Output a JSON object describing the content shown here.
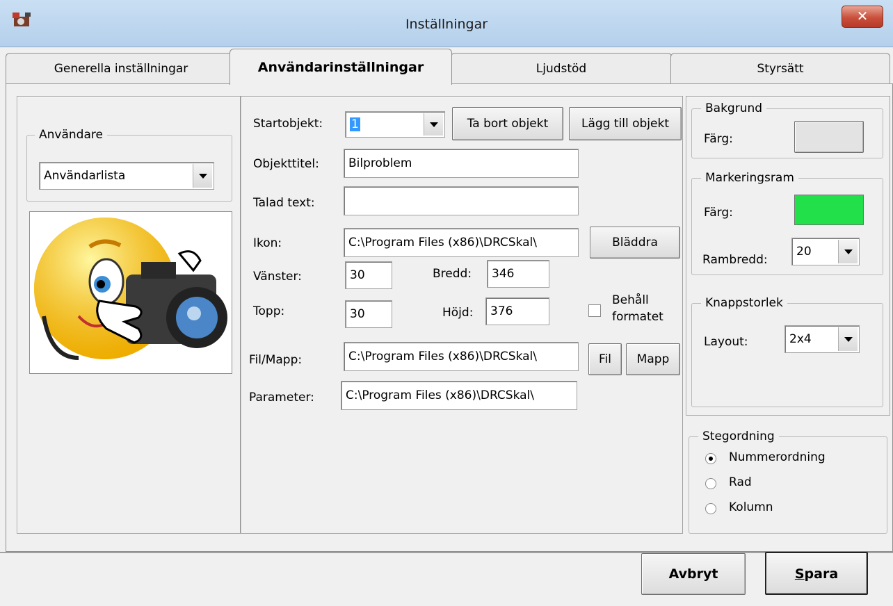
{
  "window": {
    "title": "Inställningar",
    "close_label": "✕"
  },
  "tabs": [
    "Generella inställningar",
    "Användarinställningar",
    "Ljudstöd",
    "Styrsätt"
  ],
  "users": {
    "group_label": "Användare",
    "dropdown_value": "Användarlista"
  },
  "form": {
    "startobjekt_label": "Startobjekt:",
    "startobjekt_value": "1",
    "remove_button": "Ta bort objekt",
    "add_button": "Lägg till objekt",
    "objekttitel_label": "Objekttitel:",
    "objekttitel_value": "Bilproblem",
    "talad_text_label": "Talad text:",
    "talad_text_value": "",
    "ikon_label": "Ikon:",
    "ikon_value": "C:\\Program Files (x86)\\DRCSkal\\",
    "browse_button": "Bläddra",
    "vanster_label": "Vänster:",
    "vanster_value": "30",
    "bredd_label": "Bredd:",
    "bredd_value": "346",
    "topp_label": "Topp:",
    "topp_value": "30",
    "hojd_label": "Höjd:",
    "hojd_value": "376",
    "keep_format_label_1": "Behåll",
    "keep_format_label_2": "formatet",
    "filmapp_label": "Fil/Mapp:",
    "filmapp_value": "C:\\Program Files (x86)\\DRCSkal\\",
    "fil_button": "Fil",
    "mapp_button": "Mapp",
    "parameter_label": "Parameter:",
    "parameter_value": "C:\\Program Files (x86)\\DRCSkal\\"
  },
  "background": {
    "group_label": "Bakgrund",
    "color_label": "Färg:",
    "color": "#e3e3e3"
  },
  "selection_frame": {
    "group_label": "Markeringsram",
    "color_label": "Färg:",
    "color": "#22e04a",
    "width_label": "Rambredd:",
    "width_value": "20"
  },
  "button_size": {
    "group_label": "Knappstorlek",
    "layout_label": "Layout:",
    "layout_value": "2x4"
  },
  "step_order": {
    "group_label": "Stegordning",
    "options": [
      "Nummerordning",
      "Rad",
      "Kolumn"
    ],
    "selected": "Nummerordning"
  },
  "footer": {
    "cancel_button": "Avbryt",
    "save_button_prefix": "S",
    "save_button_rest": "para"
  }
}
